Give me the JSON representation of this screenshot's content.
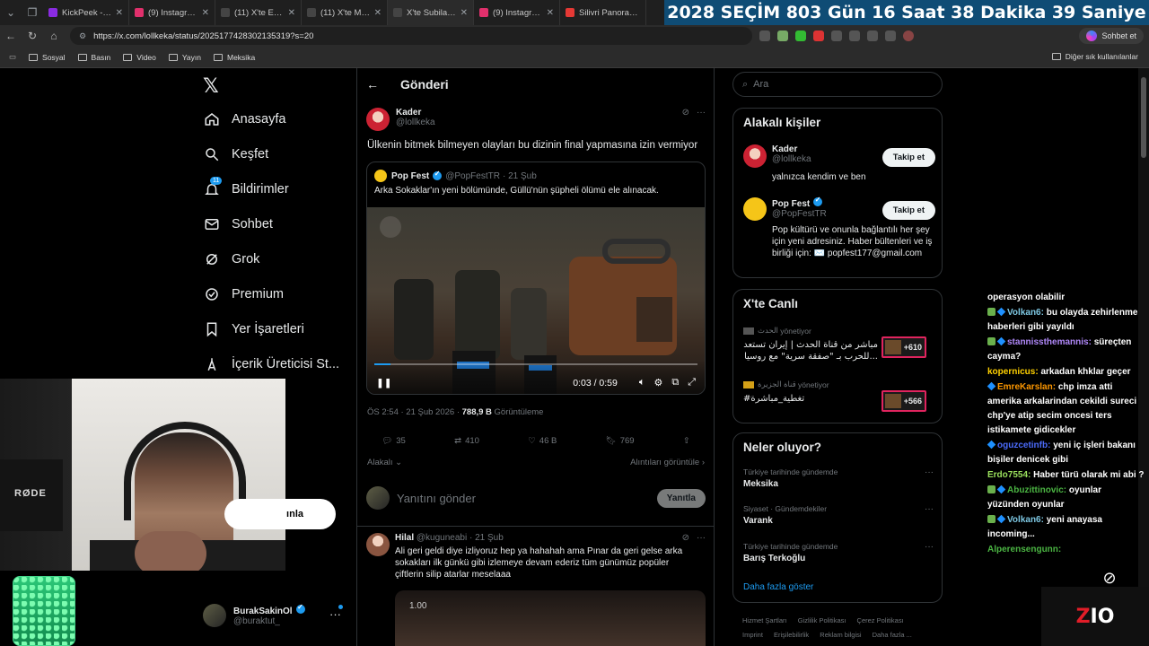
{
  "browser": {
    "tabs": [
      {
        "label": "KickPeek - Real-ti",
        "color": "#8a2be2"
      },
      {
        "label": "(9) Instagram",
        "color": "#e1306c"
      },
      {
        "label": "(11) X'te Etkili Ha",
        "color": "#444444"
      },
      {
        "label": "(11) X'te Muhami",
        "color": "#444444"
      },
      {
        "label": "X'te Subilai Hans",
        "color": "#444444"
      },
      {
        "label": "(9) Instagram",
        "color": "#e1306c"
      },
      {
        "label": "Silivri Panorama",
        "color": "#e53935"
      }
    ],
    "countdown": [
      "2028",
      "SEÇİM",
      "803 Gün",
      "16 Saat",
      "38 Dakika",
      "39 Saniye"
    ],
    "url": "https://x.com/lollkeka/status/2025177428302135319?s=20",
    "sohbet_label": "Sohbet et",
    "bookmarks": [
      "Sosyal",
      "Basın",
      "Video",
      "Yayın",
      "Meksika"
    ],
    "other_bookmarks": "Diğer sık kullanılanlar"
  },
  "nav": {
    "items": [
      {
        "label": "Anasayfa",
        "icon": "home-icon"
      },
      {
        "label": "Keşfet",
        "icon": "search-icon"
      },
      {
        "label": "Bildirimler",
        "icon": "bell-icon",
        "badge": "11"
      },
      {
        "label": "Sohbet",
        "icon": "mail-icon"
      },
      {
        "label": "Grok",
        "icon": "grok-icon"
      },
      {
        "label": "Premium",
        "icon": "premium-icon"
      },
      {
        "label": "Yer İşaretleri",
        "icon": "bookmark-icon"
      },
      {
        "label": "İçerik Üreticisi St...",
        "icon": "creator-icon"
      }
    ],
    "profile_name": "BurakSakinOl",
    "profile_handle": "@buraktut_",
    "post_button_partial": "ınla"
  },
  "post": {
    "header_title": "Gönderi",
    "author_name": "Kader",
    "author_handle": "@lollkeka",
    "text": "Ülkenin bitmek bilmeyen olayları bu dizinin final yapmasına izin vermiyor",
    "quote": {
      "name": "Pop Fest",
      "handle": "@PopFestTR",
      "date": "· 21 Şub",
      "text": "Arka Sokaklar'ın yeni bölümünde, Güllü'nün şüpheli ölümü ele alınacak."
    },
    "video": {
      "time": "0:03 / 0:59",
      "progress_pct": 5
    },
    "meta_time": "ÖS 2:54 · 21 Şub 2026 · ",
    "views": "788,9 B",
    "views_label": " Görüntüleme",
    "actions": {
      "replies": "35",
      "reposts": "410",
      "likes": "46 B",
      "bookmarks": "769"
    },
    "sort_label": "Alakalı",
    "quotes_label": "Alıntıları görüntüle",
    "reply_placeholder": "Yanıtını gönder",
    "reply_button": "Yanıtla"
  },
  "comment": {
    "name": "Hilal",
    "handle": "@kuguneabi",
    "date": "· 21 Şub",
    "text": "Ali geri geldi diye izliyoruz hep ya hahahah ama  Pınar da geri gelse arka sokakları ilk günkü gibi izlemeye devam ederiz tüm günümüz popüler çiftlerin silip atarlar meselaaa",
    "video_time": "1.00"
  },
  "right": {
    "search_placeholder": "Ara",
    "related_title": "Alakalı kişiler",
    "people": [
      {
        "name": "Kader",
        "handle": "@lollkeka",
        "bio": "yalnızca kendim ve ben",
        "follow": "Takip et"
      },
      {
        "name": "Pop Fest",
        "handle": "@PopFestTR",
        "bio": "Pop kültürü ve onunla bağlantılı her şey için yeni adresiniz. Haber bültenleri ve iş birliği için: ✉️ popfest177@gmail.com",
        "follow": "Takip et"
      }
    ],
    "live_title": "X'te Canlı",
    "live": [
      {
        "host": "الحدث",
        "role": "yönetiyor",
        "text": "مباشر من قناة الحدث | إيران تستعد للحرب بـ \"صفقة سرية\" مع روسيا...",
        "count": "+610"
      },
      {
        "host": "قناة الجزيرة",
        "role": "yönetiyor",
        "text": "#تغطية_مباشرة",
        "count": "+566"
      }
    ],
    "trends_title": "Neler oluyor?",
    "trends": [
      {
        "context": "Türkiye tarihinde gündemde",
        "name": "Meksika"
      },
      {
        "context": "Siyaset · Gündemdekiler",
        "name": "Varank"
      },
      {
        "context": "Türkiye tarihinde gündemde",
        "name": "Barış Terkoğlu"
      }
    ],
    "more": "Daha fazla göster",
    "footer": [
      "Hizmet Şartları",
      "Gizlilik Politikası",
      "Çerez Politikası",
      "Imprint",
      "Erişilebilirlik",
      "Reklam bilgisi",
      "Daha fazla ..."
    ]
  },
  "chat": {
    "messages": [
      {
        "user": "",
        "text": "operasyon olabilir"
      },
      {
        "user": "Volkan6:",
        "text": "bu olayda zehirlenme haberleri gibi yayıldı",
        "color": "#7ec8e3"
      },
      {
        "user": "stannissthemannis:",
        "text": "süreçten cayma?",
        "color": "#b088f9"
      },
      {
        "user": "kopernicus:",
        "text": "arkadan khklar geçer",
        "color": "#ffd000"
      },
      {
        "user": "EmreKarslan:",
        "text": "chp imza atti amerika arkalarindan cekildi sureci chp'ye atip secim oncesi ters istikamete gidicekler",
        "color": "#ff9800"
      },
      {
        "user": "oguzcetinfb:",
        "text": "yeni iç işleri bakanı bişiler denicek gibi",
        "color": "#4b6bfb"
      },
      {
        "user": "Erdo7554:",
        "text": "Haber türü olarak mi abi ?",
        "color": "#9be15d"
      },
      {
        "user": "Abuzittinovic:",
        "text": "oyunlar yüzünden oyunlar",
        "color": "#4bb543"
      },
      {
        "user": "Volkan6:",
        "text": "yeni anayasa incoming...",
        "color": "#7ec8e3"
      },
      {
        "user": "Alperensengunn:",
        "text": "",
        "color": "#4bb543"
      }
    ]
  },
  "overlay": {
    "rode": "RØDE",
    "zio_a": "Z",
    "zio_b": "I",
    "zio_c": "O"
  }
}
